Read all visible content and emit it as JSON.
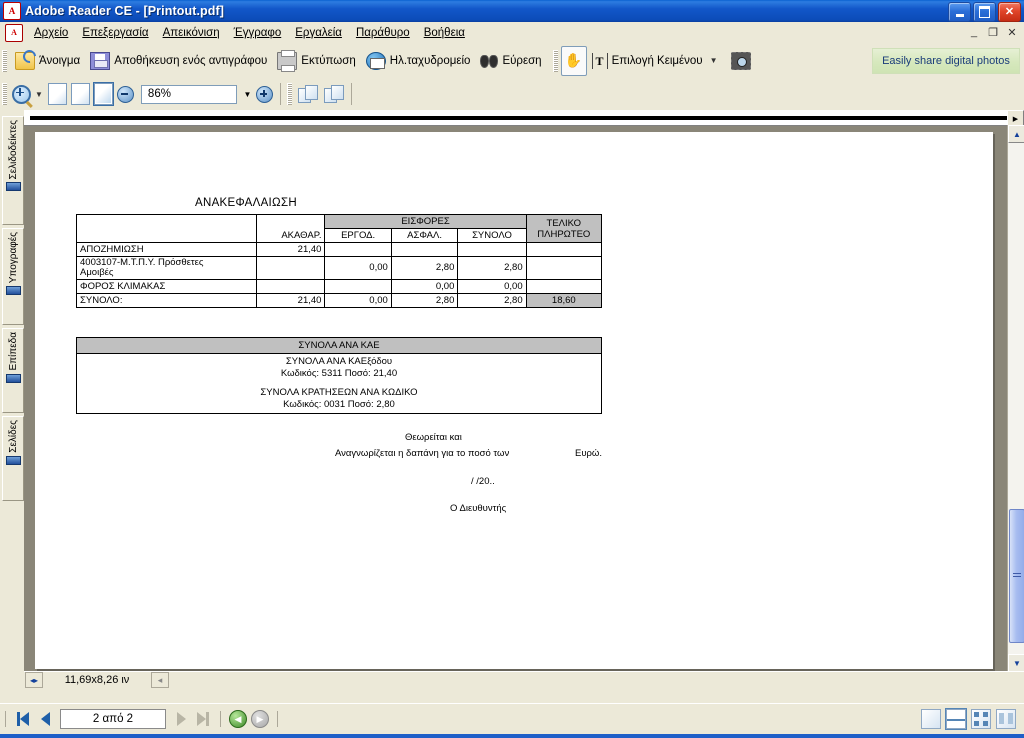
{
  "window": {
    "title": "Adobe Reader CE - [Printout.pdf]",
    "app_icon": "adobe-reader-icon",
    "buttons": {
      "minimize": "minimize-button",
      "restore": "restore-button",
      "close": "close-button"
    },
    "mdi_buttons": {
      "minimize": "_",
      "restore": "❐",
      "close": "✕"
    }
  },
  "menu": {
    "icon": "pdf-document-icon",
    "items": [
      {
        "label": "Αρχείο",
        "accel": "Α"
      },
      {
        "label": "Επεξεργασία",
        "accel": "Ε"
      },
      {
        "label": "Απεικόνιση",
        "accel": "Α"
      },
      {
        "label": "Έγγραφο",
        "accel": "Έ"
      },
      {
        "label": "Εργαλεία",
        "accel": "Ε"
      },
      {
        "label": "Παράθυρο",
        "accel": "Π"
      },
      {
        "label": "Βοήθεια",
        "accel": "Β"
      }
    ]
  },
  "toolbar_main": {
    "open_label": "Άνοιγμα",
    "save_copy_label": "Αποθήκευση ενός αντιγράφου",
    "print_label": "Εκτύπωση",
    "email_label": "Ηλ.ταχυδρομείο",
    "find_label": "Εύρεση",
    "hand_tool_label": "hand-tool",
    "select_text_label": "Επιλογή Κειμένου",
    "snapshot_label": "snapshot-tool",
    "banner_label": "Easily share digital photos"
  },
  "toolbar_zoom": {
    "zoom_value": "86%",
    "zoom_in_label": "+",
    "zoom_out_label": "−",
    "dropdown_caret": "▼",
    "page_fit_actual": "actual-size",
    "page_fit_window": "fit-page",
    "page_fit_width": "fit-width",
    "rotate_cw": "rotate-clockwise",
    "rotate_ccw": "rotate-counterclockwise"
  },
  "left_nav": {
    "tabs": [
      {
        "label": "Σελιδοδείκτες",
        "name": "bookmarks"
      },
      {
        "label": "Υπογραφές",
        "name": "signatures"
      },
      {
        "label": "Επίπεδα",
        "name": "layers"
      },
      {
        "label": "Σελίδες",
        "name": "pages"
      }
    ]
  },
  "document": {
    "page_size_text": "11,69x8,26 ιν",
    "title": "ΑΝΑΚΕΦΑΛΑΙΩΣΗ",
    "table": {
      "header_group": "ΕΙΣΦΟΡΕΣ",
      "col_gross": "ΑΚΑΘΑΡ.",
      "col_employer": "ΕΡΓΟΔ.",
      "col_insurance": "ΑΣΦΑΛ.",
      "col_subtotal": "ΣΥΝΟΛΟ",
      "col_final_l1": "ΤΕΛΙΚΟ",
      "col_final_l2": "ΠΛΗΡΩΤΕΟ",
      "rows": [
        {
          "label": "ΑΠΟΖΗΜΙΩΣΗ",
          "label2": "",
          "gross": "21,40",
          "employer": "",
          "insurance": "",
          "subtotal": "",
          "final": ""
        },
        {
          "label": "4003107-Μ.Τ.Π.Υ. Πρόσθετες",
          "label2": "Αμοιβές",
          "gross": "",
          "employer": "0,00",
          "insurance": "2,80",
          "subtotal": "2,80",
          "final": ""
        },
        {
          "label": "ΦΟΡΟΣ ΚΛΙΜΑΚΑΣ",
          "label2": "",
          "gross": "",
          "employer": "",
          "insurance": "0,00",
          "subtotal": "0,00",
          "final": ""
        }
      ],
      "total_row": {
        "label": "ΣΥΝΟΛΟ:",
        "gross": "21,40",
        "employer": "0,00",
        "insurance": "2,80",
        "subtotal": "2,80",
        "final": "18,60"
      }
    },
    "kae": {
      "header": "ΣΥΝΟΛΑ ΑΝΑ ΚΑΕ",
      "line1": "ΣΥΝΟΛΑ ΑΝΑ ΚΑΕξόδου",
      "line2": "Κωδικός: 5311  Ποσό: 21,40",
      "line3": "ΣΥΝΟΛΑ ΚΡΑΤΗΣΕΩΝ ΑΝΑ ΚΩΔΙΚΟ",
      "line4": "Κωδικός: 0031  Ποσό: 2,80"
    },
    "signature": {
      "line1": "Θεωρείται και",
      "line2": "Αναγνωρίζεται η δαπάνη για το ποσό των",
      "currency": "Ευρώ.",
      "date": "/  /20..",
      "signer": "Ο Διευθυντής"
    }
  },
  "status_bar": {
    "page_indicator": "2 από 2",
    "first_page": "first-page",
    "previous_page": "previous-page",
    "next_page": "next-page",
    "last_page": "last-page",
    "previous_view": "previous-view",
    "next_view": "next-view",
    "layout_single": "single-page",
    "layout_continuous": "continuous",
    "layout_facing": "facing",
    "layout_continuous_facing": "continuous-facing"
  },
  "colors": {
    "accent": "#1e5fc8",
    "chrome": "#ece9d8",
    "table_gray": "#c0c0c0",
    "banner_green": "#d6e8bd"
  }
}
